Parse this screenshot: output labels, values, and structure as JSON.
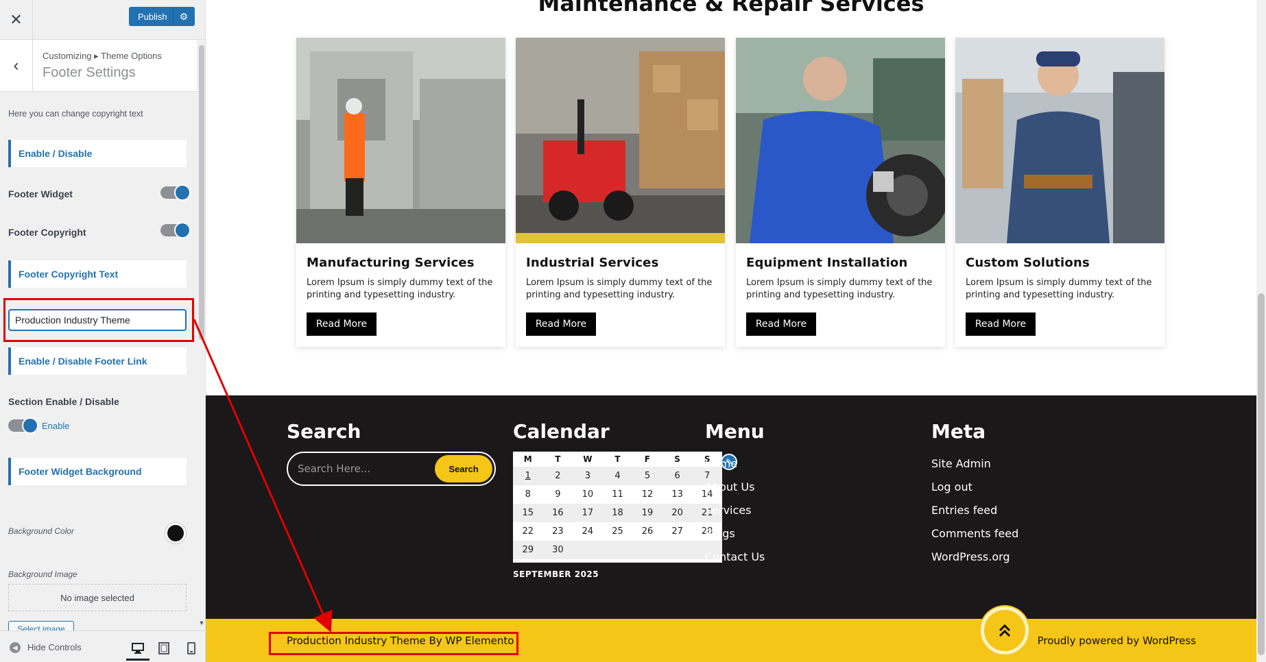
{
  "customizer": {
    "publish_label": "Publish",
    "breadcrumb": "Customizing ▸ Theme Options",
    "section_title": "Footer Settings",
    "description": "Here you can change copyright text",
    "enable_disable_title": "Enable / Disable",
    "footer_widget_label": "Footer Widget",
    "footer_copyright_label": "Footer Copyright",
    "copyright_text_title": "Footer Copyright Text",
    "copyright_input_value": "Production Industry Theme",
    "footer_link_title": "Enable / Disable Footer Link",
    "section_enable_label": "Section Enable / Disable",
    "enable_text": "Enable",
    "widget_bg_title": "Footer Widget Background",
    "bg_color_label": "Background Color",
    "bg_color_value": "#111111",
    "bg_image_label": "Background Image",
    "no_image_text": "No image selected",
    "select_image_label": "Select image",
    "hide_controls_label": "Hide Controls",
    "accent_color": "#2271b1"
  },
  "preview": {
    "section_heading": "Maintenance & Repair Services",
    "cards": [
      {
        "title": "Manufacturing Services",
        "text": "Lorem Ipsum is simply dummy text of the printing and typesetting industry.",
        "button": "Read More"
      },
      {
        "title": "Industrial Services",
        "text": "Lorem Ipsum is simply dummy text of the printing and typesetting industry.",
        "button": "Read More"
      },
      {
        "title": "Equipment Installation",
        "text": "Lorem Ipsum is simply dummy text of the printing and typesetting industry.",
        "button": "Read More"
      },
      {
        "title": "Custom Solutions",
        "text": "Lorem Ipsum is simply dummy text of the printing and typesetting industry.",
        "button": "Read More"
      }
    ],
    "footer": {
      "search_title": "Search",
      "search_placeholder": "Search Here...",
      "search_button": "Search",
      "calendar_title": "Calendar",
      "calendar_days": [
        "M",
        "T",
        "W",
        "T",
        "F",
        "S",
        "S"
      ],
      "calendar_weeks": [
        [
          "1",
          "2",
          "3",
          "4",
          "5",
          "6",
          "7"
        ],
        [
          "8",
          "9",
          "10",
          "11",
          "12",
          "13",
          "14"
        ],
        [
          "15",
          "16",
          "17",
          "18",
          "19",
          "20",
          "21"
        ],
        [
          "22",
          "23",
          "24",
          "25",
          "26",
          "27",
          "28"
        ],
        [
          "29",
          "30",
          "",
          "",
          "",
          "",
          ""
        ]
      ],
      "calendar_caption": "SEPTEMBER 2025",
      "menu_title": "Menu",
      "menu_links": [
        "Home",
        "About Us",
        "Services",
        "Blogs",
        "Contact Us"
      ],
      "meta_title": "Meta",
      "meta_links": [
        "Site Admin",
        "Log out",
        "Entries feed",
        "Comments feed",
        "WordPress.org"
      ],
      "copyright": "Production Industry Theme By WP Elemento",
      "powered_by": "Proudly powered by WordPress",
      "footer_bg": "#1a1818",
      "accent_yellow": "#f5c518"
    }
  }
}
